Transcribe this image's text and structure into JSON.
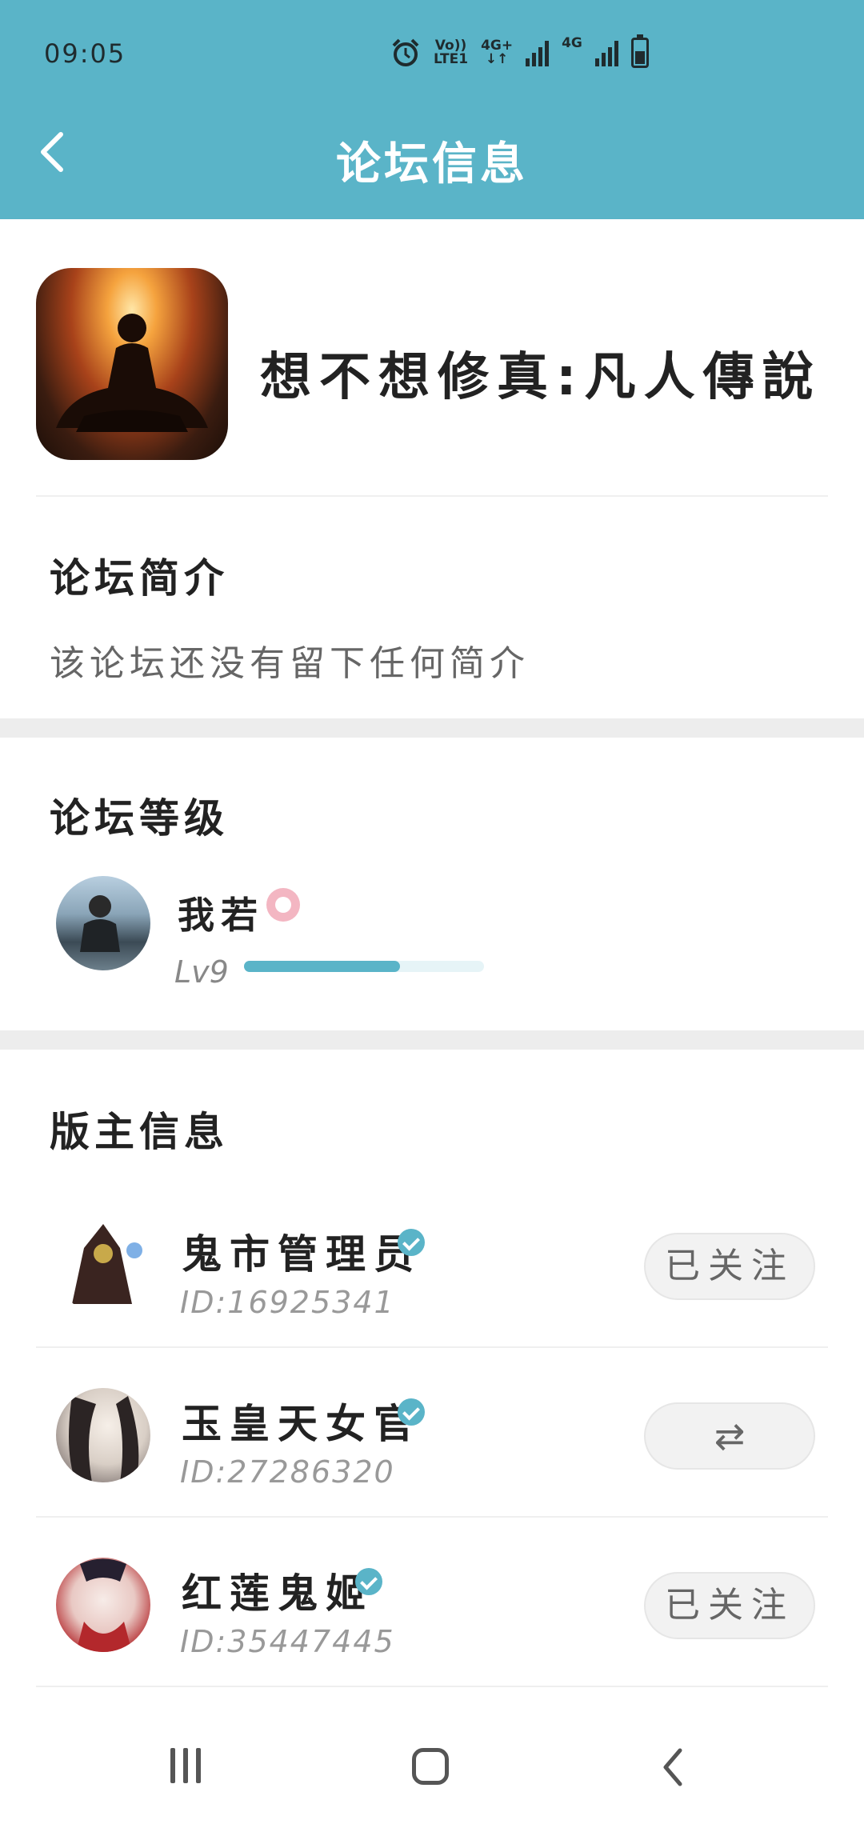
{
  "status_bar": {
    "time": "09:05",
    "network_1_top": "Vo))",
    "network_1_bottom": "LTE1",
    "network_2_top": "4G+",
    "network_2_bottom": "↓↑",
    "network_3": "4G",
    "icons": [
      "alarm-icon",
      "signal-icon",
      "battery-icon"
    ]
  },
  "header": {
    "title": "论坛信息",
    "back_icon": "chevron-left-icon",
    "background_color": "#5ab4c8"
  },
  "forum": {
    "name": "想不想修真:凡人傳說"
  },
  "intro_section": {
    "title": "论坛简介",
    "text": "该论坛还没有留下任何简介"
  },
  "level_section": {
    "title": "论坛等级",
    "user_name": "我若",
    "level_label": "Lv9",
    "progress": 0.65
  },
  "moderators_section": {
    "title": "版主信息",
    "moderators": [
      {
        "name": "鬼市管理员",
        "id": "ID:16925341",
        "button": "已关注"
      },
      {
        "name": "玉皇天女官",
        "id": "ID:27286320",
        "button": "⇄"
      },
      {
        "name": "红莲鬼姬",
        "id": "ID:35447445",
        "button": "已关注"
      }
    ]
  },
  "nav_bar": {
    "icons": [
      "recent-apps-icon",
      "home-icon",
      "back-icon"
    ]
  }
}
